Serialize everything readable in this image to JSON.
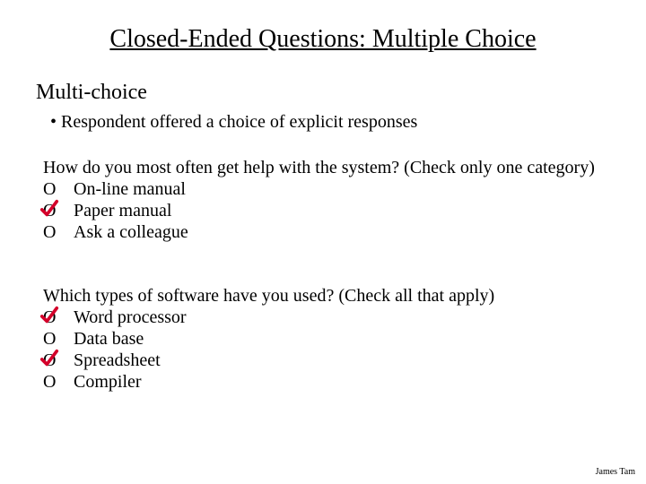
{
  "title": "Closed-Ended Questions: Multiple Choice",
  "subtitle": "Multi-choice",
  "bullet": "• Respondent offered a choice of explicit responses",
  "q1": {
    "prompt": "How do you most often get help with the system? (Check only one category)",
    "options": [
      {
        "mark": "O",
        "label": "On-line manual",
        "checked": false
      },
      {
        "mark": "O",
        "label": "Paper manual",
        "checked": true
      },
      {
        "mark": "O",
        "label": "Ask a colleague",
        "checked": false
      }
    ]
  },
  "q2": {
    "prompt": "Which types of software have you used? (Check all that apply)",
    "options": [
      {
        "mark": "O",
        "label": "Word processor",
        "checked": true
      },
      {
        "mark": "O",
        "label": "Data base",
        "checked": false
      },
      {
        "mark": "O",
        "label": "Spreadsheet",
        "checked": true
      },
      {
        "mark": "O",
        "label": "Compiler",
        "checked": false
      }
    ]
  },
  "footer": "James Tam",
  "check_color": "#d4002a"
}
